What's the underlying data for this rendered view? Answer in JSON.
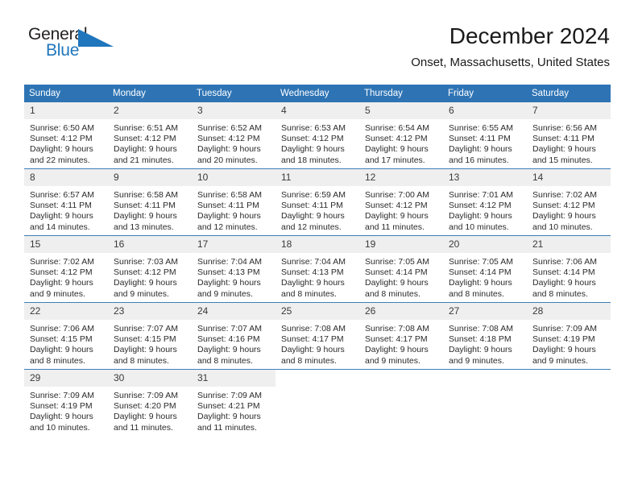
{
  "branding": {
    "logo_text_primary": "General",
    "logo_text_secondary": "Blue",
    "logo_accent_color": "#1f76bc"
  },
  "header": {
    "title": "December 2024",
    "subtitle": "Onset, Massachusetts, United States"
  },
  "calendar": {
    "accent_color": "#2e74b5",
    "daynum_background": "#efefef",
    "weekday_headers": [
      "Sunday",
      "Monday",
      "Tuesday",
      "Wednesday",
      "Thursday",
      "Friday",
      "Saturday"
    ],
    "weeks": [
      [
        {
          "day": "1",
          "sunrise": "Sunrise: 6:50 AM",
          "sunset": "Sunset: 4:12 PM",
          "daylight_line1": "Daylight: 9 hours",
          "daylight_line2": "and 22 minutes."
        },
        {
          "day": "2",
          "sunrise": "Sunrise: 6:51 AM",
          "sunset": "Sunset: 4:12 PM",
          "daylight_line1": "Daylight: 9 hours",
          "daylight_line2": "and 21 minutes."
        },
        {
          "day": "3",
          "sunrise": "Sunrise: 6:52 AM",
          "sunset": "Sunset: 4:12 PM",
          "daylight_line1": "Daylight: 9 hours",
          "daylight_line2": "and 20 minutes."
        },
        {
          "day": "4",
          "sunrise": "Sunrise: 6:53 AM",
          "sunset": "Sunset: 4:12 PM",
          "daylight_line1": "Daylight: 9 hours",
          "daylight_line2": "and 18 minutes."
        },
        {
          "day": "5",
          "sunrise": "Sunrise: 6:54 AM",
          "sunset": "Sunset: 4:12 PM",
          "daylight_line1": "Daylight: 9 hours",
          "daylight_line2": "and 17 minutes."
        },
        {
          "day": "6",
          "sunrise": "Sunrise: 6:55 AM",
          "sunset": "Sunset: 4:11 PM",
          "daylight_line1": "Daylight: 9 hours",
          "daylight_line2": "and 16 minutes."
        },
        {
          "day": "7",
          "sunrise": "Sunrise: 6:56 AM",
          "sunset": "Sunset: 4:11 PM",
          "daylight_line1": "Daylight: 9 hours",
          "daylight_line2": "and 15 minutes."
        }
      ],
      [
        {
          "day": "8",
          "sunrise": "Sunrise: 6:57 AM",
          "sunset": "Sunset: 4:11 PM",
          "daylight_line1": "Daylight: 9 hours",
          "daylight_line2": "and 14 minutes."
        },
        {
          "day": "9",
          "sunrise": "Sunrise: 6:58 AM",
          "sunset": "Sunset: 4:11 PM",
          "daylight_line1": "Daylight: 9 hours",
          "daylight_line2": "and 13 minutes."
        },
        {
          "day": "10",
          "sunrise": "Sunrise: 6:58 AM",
          "sunset": "Sunset: 4:11 PM",
          "daylight_line1": "Daylight: 9 hours",
          "daylight_line2": "and 12 minutes."
        },
        {
          "day": "11",
          "sunrise": "Sunrise: 6:59 AM",
          "sunset": "Sunset: 4:11 PM",
          "daylight_line1": "Daylight: 9 hours",
          "daylight_line2": "and 12 minutes."
        },
        {
          "day": "12",
          "sunrise": "Sunrise: 7:00 AM",
          "sunset": "Sunset: 4:12 PM",
          "daylight_line1": "Daylight: 9 hours",
          "daylight_line2": "and 11 minutes."
        },
        {
          "day": "13",
          "sunrise": "Sunrise: 7:01 AM",
          "sunset": "Sunset: 4:12 PM",
          "daylight_line1": "Daylight: 9 hours",
          "daylight_line2": "and 10 minutes."
        },
        {
          "day": "14",
          "sunrise": "Sunrise: 7:02 AM",
          "sunset": "Sunset: 4:12 PM",
          "daylight_line1": "Daylight: 9 hours",
          "daylight_line2": "and 10 minutes."
        }
      ],
      [
        {
          "day": "15",
          "sunrise": "Sunrise: 7:02 AM",
          "sunset": "Sunset: 4:12 PM",
          "daylight_line1": "Daylight: 9 hours",
          "daylight_line2": "and 9 minutes."
        },
        {
          "day": "16",
          "sunrise": "Sunrise: 7:03 AM",
          "sunset": "Sunset: 4:12 PM",
          "daylight_line1": "Daylight: 9 hours",
          "daylight_line2": "and 9 minutes."
        },
        {
          "day": "17",
          "sunrise": "Sunrise: 7:04 AM",
          "sunset": "Sunset: 4:13 PM",
          "daylight_line1": "Daylight: 9 hours",
          "daylight_line2": "and 9 minutes."
        },
        {
          "day": "18",
          "sunrise": "Sunrise: 7:04 AM",
          "sunset": "Sunset: 4:13 PM",
          "daylight_line1": "Daylight: 9 hours",
          "daylight_line2": "and 8 minutes."
        },
        {
          "day": "19",
          "sunrise": "Sunrise: 7:05 AM",
          "sunset": "Sunset: 4:14 PM",
          "daylight_line1": "Daylight: 9 hours",
          "daylight_line2": "and 8 minutes."
        },
        {
          "day": "20",
          "sunrise": "Sunrise: 7:05 AM",
          "sunset": "Sunset: 4:14 PM",
          "daylight_line1": "Daylight: 9 hours",
          "daylight_line2": "and 8 minutes."
        },
        {
          "day": "21",
          "sunrise": "Sunrise: 7:06 AM",
          "sunset": "Sunset: 4:14 PM",
          "daylight_line1": "Daylight: 9 hours",
          "daylight_line2": "and 8 minutes."
        }
      ],
      [
        {
          "day": "22",
          "sunrise": "Sunrise: 7:06 AM",
          "sunset": "Sunset: 4:15 PM",
          "daylight_line1": "Daylight: 9 hours",
          "daylight_line2": "and 8 minutes."
        },
        {
          "day": "23",
          "sunrise": "Sunrise: 7:07 AM",
          "sunset": "Sunset: 4:15 PM",
          "daylight_line1": "Daylight: 9 hours",
          "daylight_line2": "and 8 minutes."
        },
        {
          "day": "24",
          "sunrise": "Sunrise: 7:07 AM",
          "sunset": "Sunset: 4:16 PM",
          "daylight_line1": "Daylight: 9 hours",
          "daylight_line2": "and 8 minutes."
        },
        {
          "day": "25",
          "sunrise": "Sunrise: 7:08 AM",
          "sunset": "Sunset: 4:17 PM",
          "daylight_line1": "Daylight: 9 hours",
          "daylight_line2": "and 8 minutes."
        },
        {
          "day": "26",
          "sunrise": "Sunrise: 7:08 AM",
          "sunset": "Sunset: 4:17 PM",
          "daylight_line1": "Daylight: 9 hours",
          "daylight_line2": "and 9 minutes."
        },
        {
          "day": "27",
          "sunrise": "Sunrise: 7:08 AM",
          "sunset": "Sunset: 4:18 PM",
          "daylight_line1": "Daylight: 9 hours",
          "daylight_line2": "and 9 minutes."
        },
        {
          "day": "28",
          "sunrise": "Sunrise: 7:09 AM",
          "sunset": "Sunset: 4:19 PM",
          "daylight_line1": "Daylight: 9 hours",
          "daylight_line2": "and 9 minutes."
        }
      ],
      [
        {
          "day": "29",
          "sunrise": "Sunrise: 7:09 AM",
          "sunset": "Sunset: 4:19 PM",
          "daylight_line1": "Daylight: 9 hours",
          "daylight_line2": "and 10 minutes."
        },
        {
          "day": "30",
          "sunrise": "Sunrise: 7:09 AM",
          "sunset": "Sunset: 4:20 PM",
          "daylight_line1": "Daylight: 9 hours",
          "daylight_line2": "and 11 minutes."
        },
        {
          "day": "31",
          "sunrise": "Sunrise: 7:09 AM",
          "sunset": "Sunset: 4:21 PM",
          "daylight_line1": "Daylight: 9 hours",
          "daylight_line2": "and 11 minutes."
        },
        {
          "day": "",
          "sunrise": "",
          "sunset": "",
          "daylight_line1": "",
          "daylight_line2": ""
        },
        {
          "day": "",
          "sunrise": "",
          "sunset": "",
          "daylight_line1": "",
          "daylight_line2": ""
        },
        {
          "day": "",
          "sunrise": "",
          "sunset": "",
          "daylight_line1": "",
          "daylight_line2": ""
        },
        {
          "day": "",
          "sunrise": "",
          "sunset": "",
          "daylight_line1": "",
          "daylight_line2": ""
        }
      ]
    ]
  }
}
